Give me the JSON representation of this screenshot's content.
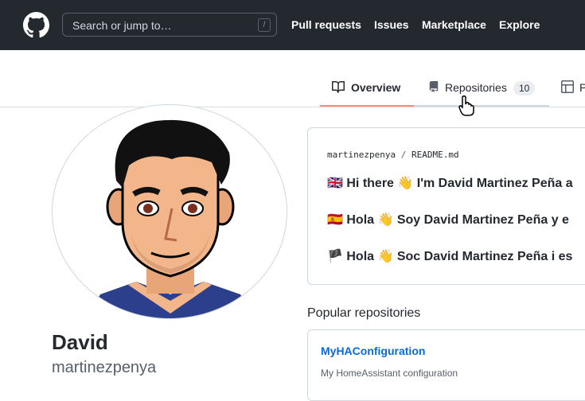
{
  "header": {
    "logo_icon": "github-mark-icon",
    "search_placeholder": "Search or jump to…",
    "search_shortcut": "/",
    "nav": [
      "Pull requests",
      "Issues",
      "Marketplace",
      "Explore"
    ]
  },
  "tabs": {
    "overview": {
      "label": "Overview",
      "icon": "book-icon"
    },
    "repositories": {
      "label": "Repositories",
      "count": "10",
      "icon": "repo-icon"
    },
    "projects": {
      "label": "P",
      "icon": "table-icon"
    }
  },
  "profile": {
    "name": "David",
    "login": "martinezpenya"
  },
  "readme": {
    "owner": "martinezpenya",
    "separator": "/",
    "file": "README.md",
    "lines": [
      "🇬🇧 Hi there 👋 I'm David Martinez Peña a",
      "🇪🇸 Hola 👋 Soy David Martinez Peña y e",
      "🏴 Hola 👋 Soc David Martinez Peña i es"
    ]
  },
  "popular": {
    "heading": "Popular repositories",
    "repos": [
      {
        "name": "MyHAConfiguration",
        "description": "My HomeAssistant configuration"
      }
    ]
  },
  "colors": {
    "header_bg": "#24292f",
    "tab_underline": "#fd8c73",
    "link": "#0969da"
  }
}
